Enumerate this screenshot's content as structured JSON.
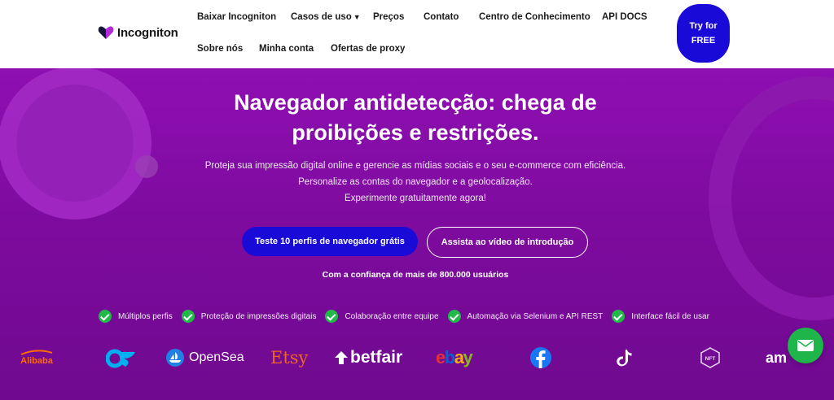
{
  "header": {
    "logo_text": "Incogniton",
    "nav": [
      {
        "label": "Baixar Incogniton"
      },
      {
        "label": "Casos de uso"
      },
      {
        "label": "Preços"
      },
      {
        "label": "Contato"
      },
      {
        "label": "Centro de Conhecimento"
      },
      {
        "label": "API DOCS"
      },
      {
        "label": "Sobre nós"
      },
      {
        "label": "Minha conta"
      },
      {
        "label": "Ofertas de proxy"
      }
    ],
    "try_button": "Try for FREE"
  },
  "hero": {
    "title_line1": "Navegador antidetecção: chega de",
    "title_line2": "proibições e restrições.",
    "subtitle_line1": "Proteja sua impressão digital online e gerencie as mídias sociais e o seu e-commerce com eficiência.",
    "subtitle_line2": "Personalize as contas do navegador e a geolocalização.",
    "subtitle_line3": "Experimente gratuitamente agora!",
    "primary_button": "Teste 10 perfis de navegador grátis",
    "secondary_button": "Assista ao vídeo de introdução",
    "trust_text": "Com a confiança de mais de 800.000 usuários"
  },
  "features": [
    {
      "label": "Múltiplos perfis"
    },
    {
      "label": "Proteção de impressões digitais"
    },
    {
      "label": "Colaboração entre equipe"
    },
    {
      "label": "Automação via Selenium e API REST"
    },
    {
      "label": "Interface fácil de usar"
    }
  ],
  "brands": {
    "alibaba": "Alibaba",
    "opensea": "OpenSea",
    "etsy": "Etsy",
    "betfair": "betfair",
    "ebay": [
      "e",
      "b",
      "a",
      "y"
    ],
    "nft": "NFT",
    "amazon": "am"
  },
  "colors": {
    "accent_blue": "#1a0ad8",
    "hero_purple": "#8f0fb2",
    "check_green": "#20b94a",
    "ebay": [
      "#e53238",
      "#0064d2",
      "#f5af02",
      "#86b817"
    ]
  },
  "icons": [
    "incogniton-logo-icon",
    "chevron-down-icon",
    "check-icon",
    "opensea-icon",
    "facebook-icon",
    "tiktok-icon",
    "nft-icon",
    "onlyfans-icon",
    "mail-icon"
  ]
}
